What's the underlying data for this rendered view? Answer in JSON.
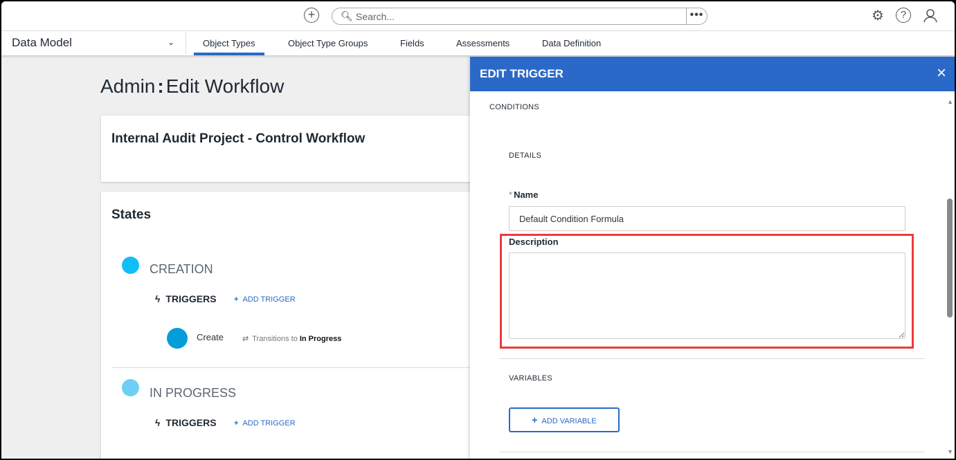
{
  "topbar": {
    "search_placeholder": "Search...",
    "more": "•••"
  },
  "nav": {
    "module": "Data Model",
    "tabs": [
      "Object Types",
      "Object Type Groups",
      "Fields",
      "Assessments",
      "Data Definition"
    ]
  },
  "page": {
    "title_prefix": "Admin",
    "title_sep": ":",
    "title": "Edit Workflow",
    "workflow_name": "Internal Audit Project - Control Workflow",
    "states_heading": "States"
  },
  "states": [
    {
      "name": "CREATION",
      "color": "#13bdf7",
      "triggers_label": "TRIGGERS",
      "add_trigger": "ADD TRIGGER",
      "trigger": {
        "name": "Create",
        "transitions_label": "Transitions to",
        "target": "In Progress",
        "color": "#039ddb"
      }
    },
    {
      "name": "IN PROGRESS",
      "color": "#6ecff5",
      "triggers_label": "TRIGGERS",
      "add_trigger": "ADD TRIGGER"
    }
  ],
  "panel": {
    "title": "EDIT TRIGGER",
    "close": "×",
    "conditions": "CONDITIONS",
    "details": "DETAILS",
    "required_mark": "*",
    "name_label": "Name",
    "name_value": "Default Condition Formula",
    "description_label": "Description",
    "description_value": "",
    "variables": "VARIABLES",
    "add_variable": "ADD VARIABLE"
  },
  "colors": {
    "accent": "#2a69c7",
    "highlight": "#f0393d"
  }
}
